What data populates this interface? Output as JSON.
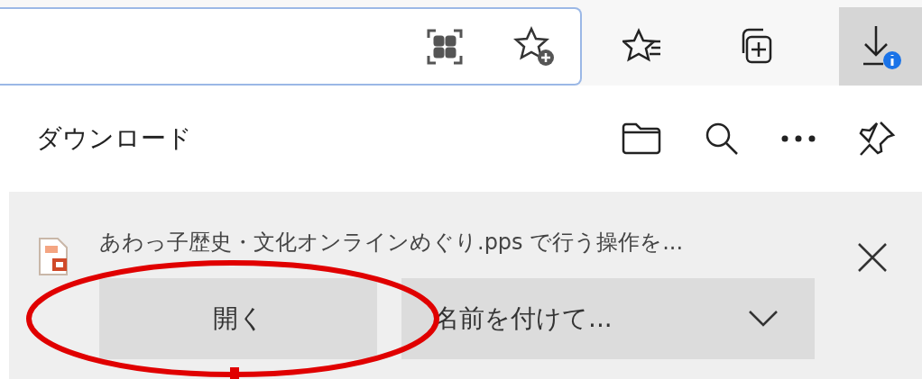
{
  "toolbar": {
    "downloads_selected": true
  },
  "panel": {
    "title": "ダウンロード"
  },
  "download": {
    "message": "あわっ子歴史・文化オンラインめぐり.pps で行う操作を...",
    "buttons": [
      {
        "kind": "plain",
        "label": "開く"
      },
      {
        "kind": "dropdown",
        "label": "名前を付けて..."
      }
    ]
  }
}
